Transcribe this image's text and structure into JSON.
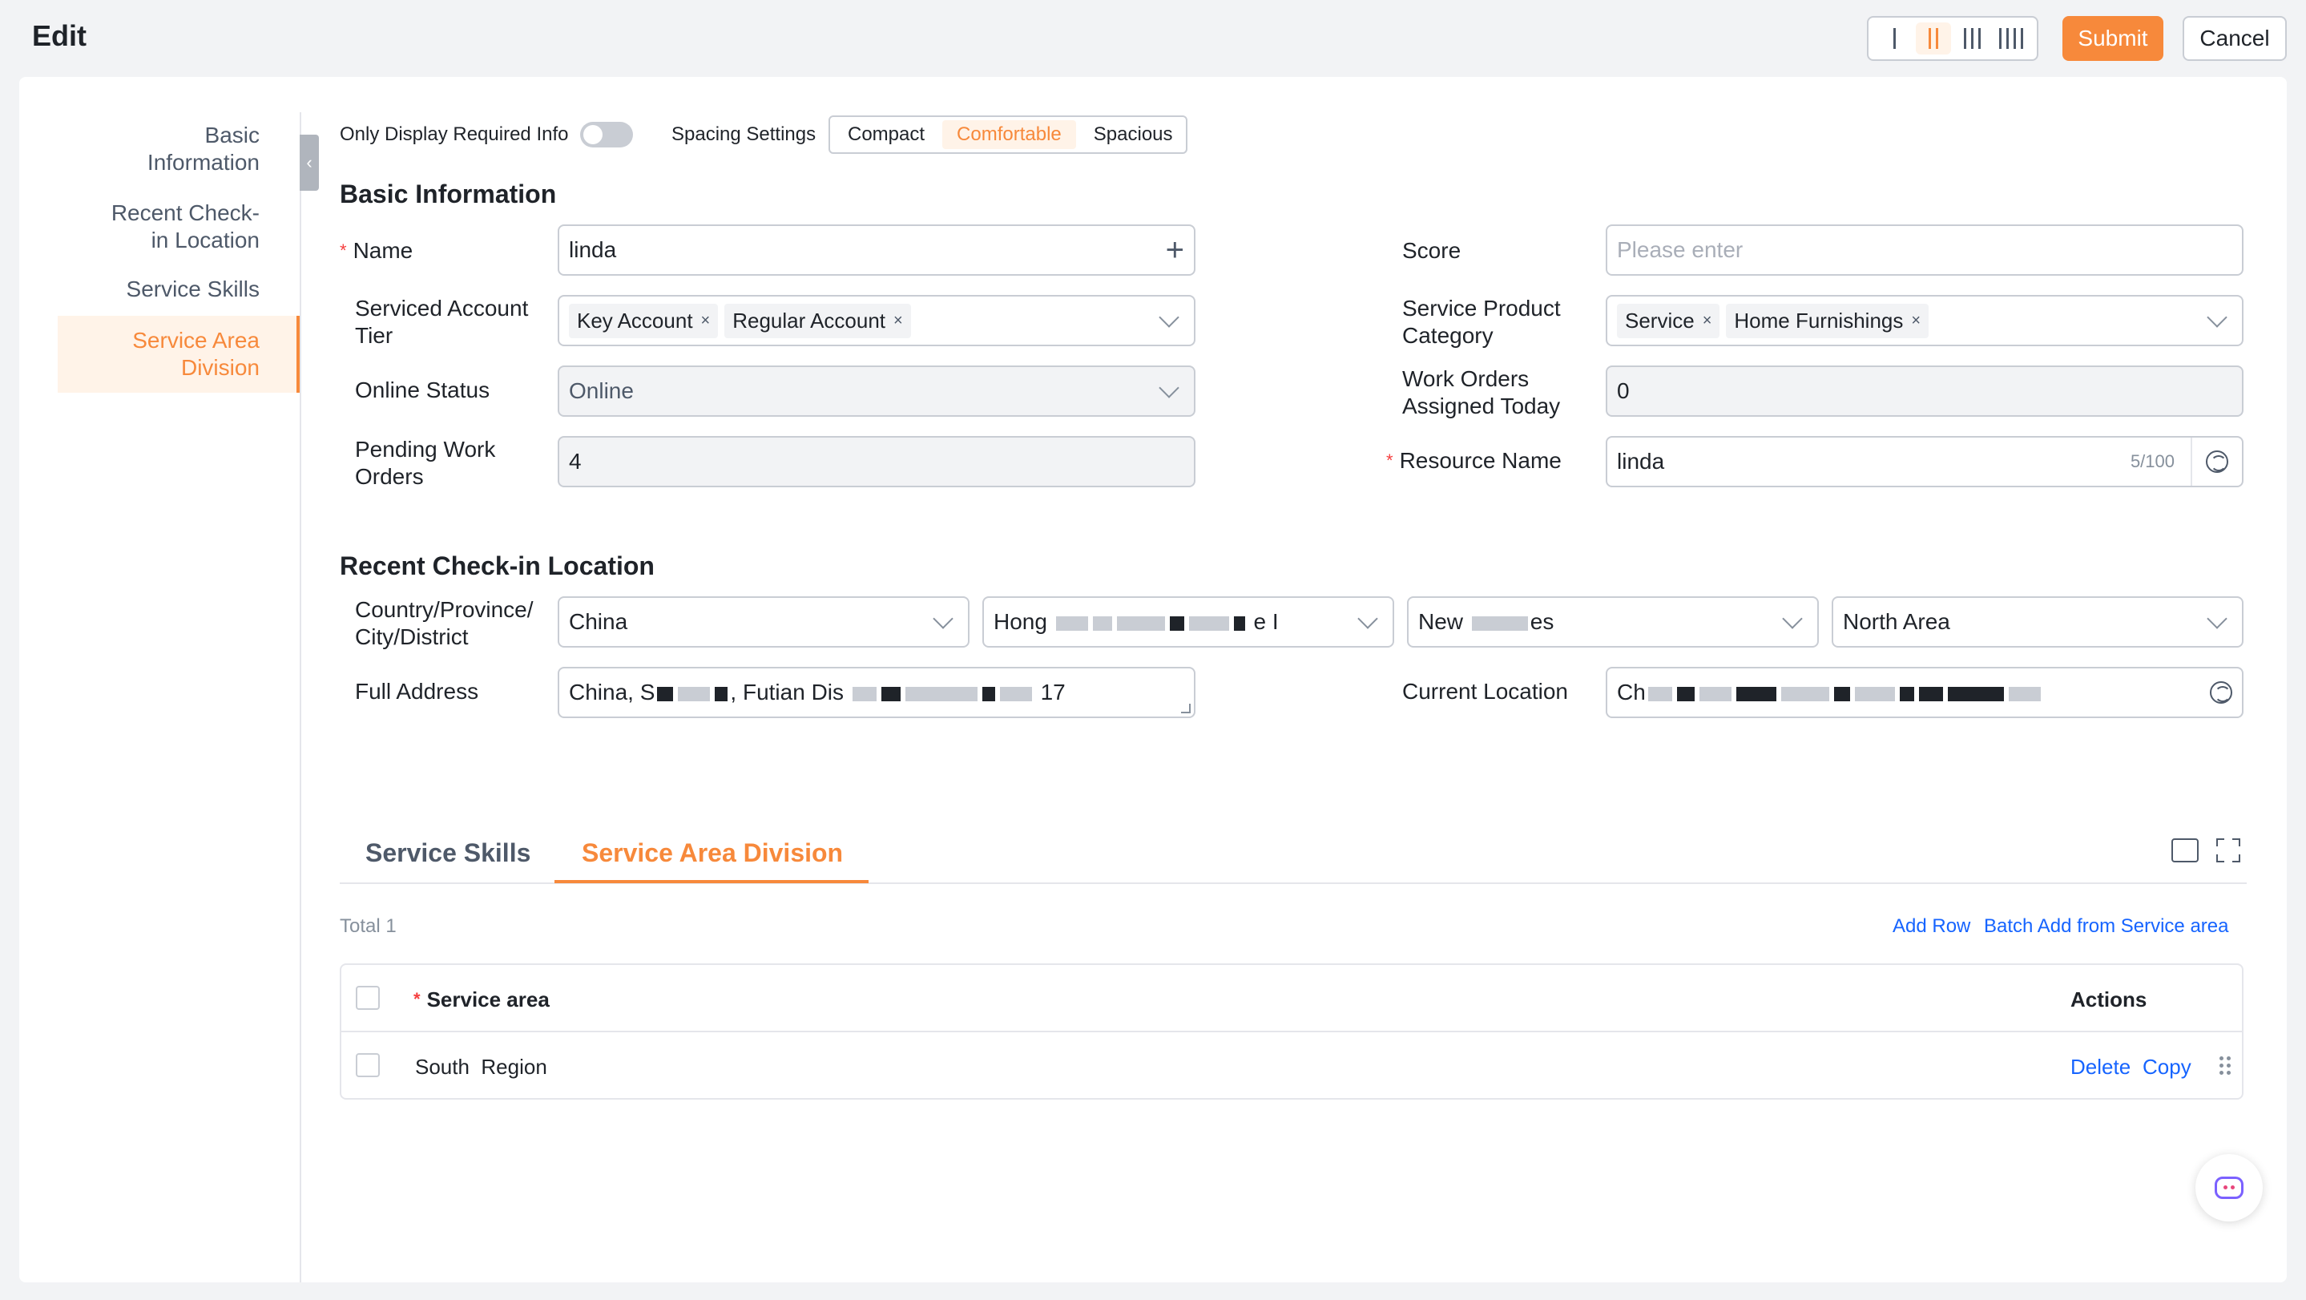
{
  "header": {
    "title": "Edit",
    "submit_label": "Submit",
    "cancel_label": "Cancel",
    "layout_options": [
      "1-column",
      "2-column",
      "3-column",
      "4-column"
    ],
    "layout_selected": "2-column"
  },
  "anchor_nav": {
    "items": [
      {
        "label_line1": "Basic",
        "label_line2": "Information"
      },
      {
        "label_line1": "Recent Check-",
        "label_line2": "in Location"
      },
      {
        "label_line1": "Service Skills",
        "label_line2": ""
      },
      {
        "label_line1": "Service Area",
        "label_line2": "Division"
      }
    ],
    "active_index": 3
  },
  "settings": {
    "required_only_label": "Only Display Required Info",
    "required_only_on": false,
    "spacing_label": "Spacing Settings",
    "spacing_options": [
      "Compact",
      "Comfortable",
      "Spacious"
    ],
    "spacing_selected": "Comfortable"
  },
  "basic_info": {
    "title": "Basic Information",
    "name": {
      "label": "Name",
      "value": "linda"
    },
    "score": {
      "label": "Score",
      "placeholder": "Please enter"
    },
    "account_tier": {
      "label_line1": "Serviced Account",
      "label_line2": "Tier",
      "tags": [
        "Key Account",
        "Regular Account"
      ]
    },
    "product_category": {
      "label_line1": "Service Product",
      "label_line2": "Category",
      "tags": [
        "Service",
        "Home Furnishings"
      ]
    },
    "online_status": {
      "label": "Online Status",
      "value": "Online"
    },
    "work_orders_today": {
      "label_line1": "Work Orders",
      "label_line2": "Assigned Today",
      "value": "0"
    },
    "pending_orders": {
      "label_line1": "Pending Work",
      "label_line2": "Orders",
      "value": "4"
    },
    "resource_name": {
      "label": "Resource Name",
      "value": "linda",
      "counter": "5/100"
    }
  },
  "checkin": {
    "title": "Recent Check-in Location",
    "region_label_line1": "Country/Province/",
    "region_label_line2": "City/District",
    "country": "China",
    "province_start": "Hong",
    "province_end": "e I",
    "city_start": "New",
    "city_end": "es",
    "district": "North Area",
    "address_label": "Full Address",
    "address_start": "China, S",
    "address_mid": "Futian Dis",
    "address_end": "17",
    "current_label": "Current Location",
    "current_start": "Ch"
  },
  "tabs": {
    "items": [
      "Service Skills",
      "Service Area Division"
    ],
    "active": "Service Area Division"
  },
  "table_section": {
    "total_label": "Total 1",
    "add_row": "Add Row",
    "batch_add": "Batch Add from Service area",
    "col_service_area": "Service area",
    "col_actions": "Actions",
    "rows": [
      {
        "service_area": "South  Region",
        "delete": "Delete",
        "copy": "Copy"
      }
    ]
  },
  "colors": {
    "accent": "#f7893b",
    "link": "#1664ff",
    "required": "#f53f3f"
  }
}
